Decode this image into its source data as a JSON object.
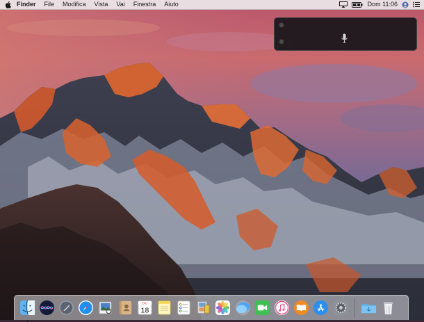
{
  "menubar": {
    "apple_icon": "apple-logo-icon",
    "app_name": "Finder",
    "menus": [
      "File",
      "Modifica",
      "Vista",
      "Vai",
      "Finestra",
      "Aiuto"
    ],
    "status_icons": [
      "airplay-icon",
      "battery-icon",
      "user-icon",
      "notification-center-icon"
    ],
    "clock": "Dom 11:06"
  },
  "dictation": {
    "icon": "microphone-icon"
  },
  "dock": {
    "apps": [
      "finder",
      "siri",
      "launchpad",
      "safari",
      "preview",
      "contacts",
      "calendar",
      "notes",
      "reminders",
      "photo-booth",
      "photos",
      "messages",
      "facetime",
      "itunes",
      "ibooks",
      "app-store",
      "system-preferences"
    ],
    "calendar_day": "18",
    "calendar_month": "DIC"
  },
  "colors": {
    "menubar_bg": "#ece8ea",
    "dictation_bg": "#18161a",
    "dock_bg": "#dcdce2"
  }
}
